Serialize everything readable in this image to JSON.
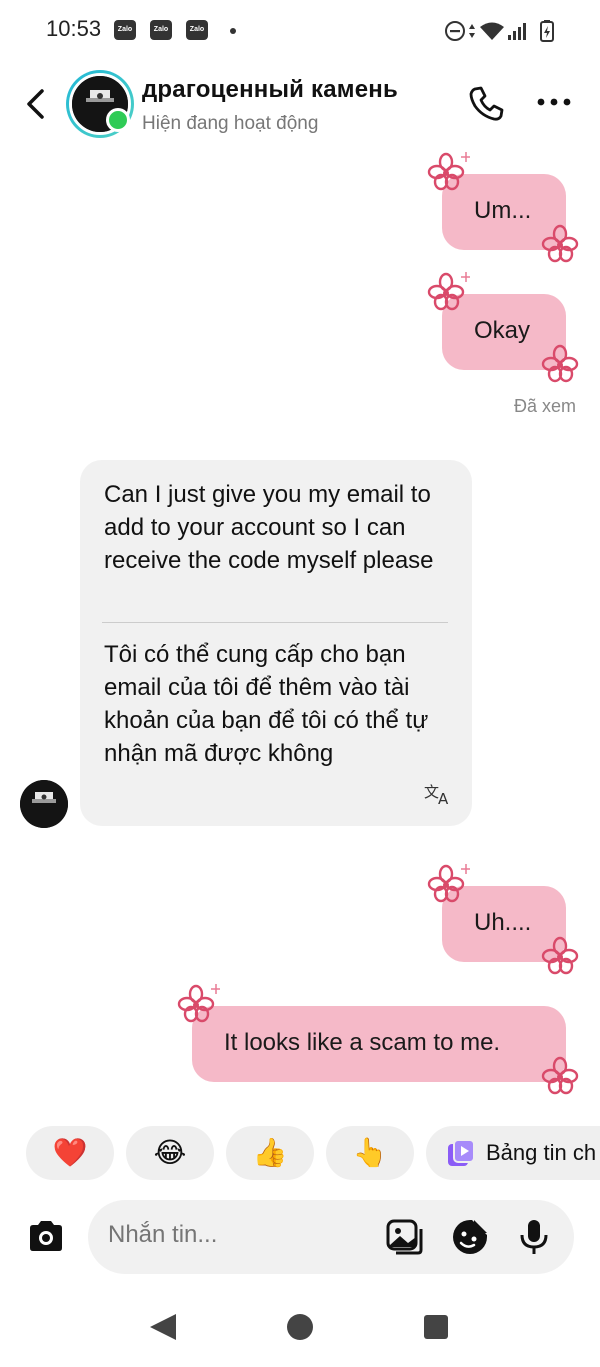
{
  "status_bar": {
    "time": "10:53",
    "notifications": [
      "Zalo",
      "Zalo",
      "Zalo"
    ],
    "icons": [
      "dnd-icon",
      "data-arrows-icon",
      "wifi-icon",
      "signal-icon",
      "battery-charging-icon"
    ]
  },
  "header": {
    "contact_name": "драгоценный камень",
    "status": "Hiện đang hoạt động",
    "online_color": "#2fcb56",
    "icons": [
      "back-arrow-icon",
      "phone-icon",
      "more-options-icon"
    ]
  },
  "messages": [
    {
      "direction": "outgoing",
      "text": "Um..."
    },
    {
      "direction": "outgoing",
      "text": "Okay"
    },
    {
      "direction": "incoming",
      "text": "Can I just give you my email to add to your account so I can receive the code myself please",
      "translation": "Tôi có thể cung cấp cho bạn email của tôi để thêm vào tài khoản của bạn để tôi có thể tự nhận mã được không"
    },
    {
      "direction": "outgoing",
      "text": "Uh...."
    },
    {
      "direction": "outgoing",
      "text": "It looks like a scam to me."
    }
  ],
  "seen_label": "Đã xem",
  "quick_reactions": [
    {
      "icon": "heart-emoji",
      "glyph": "❤️"
    },
    {
      "icon": "laughing-emoji",
      "glyph": "😂"
    },
    {
      "icon": "thumbs-up-emoji",
      "glyph": "👍"
    },
    {
      "icon": "pointing-hand-emoji",
      "glyph": "👆"
    }
  ],
  "story_chip_label": "Bảng tin ch",
  "composer": {
    "placeholder": "Nhắn tin...",
    "icons": [
      "camera-icon",
      "gallery-icon",
      "sticker-icon",
      "microphone-icon"
    ]
  },
  "colors": {
    "outgoing_bubble": "#f5b9c8",
    "incoming_bubble": "#f1f1f1",
    "flower": "#d94a6a"
  }
}
